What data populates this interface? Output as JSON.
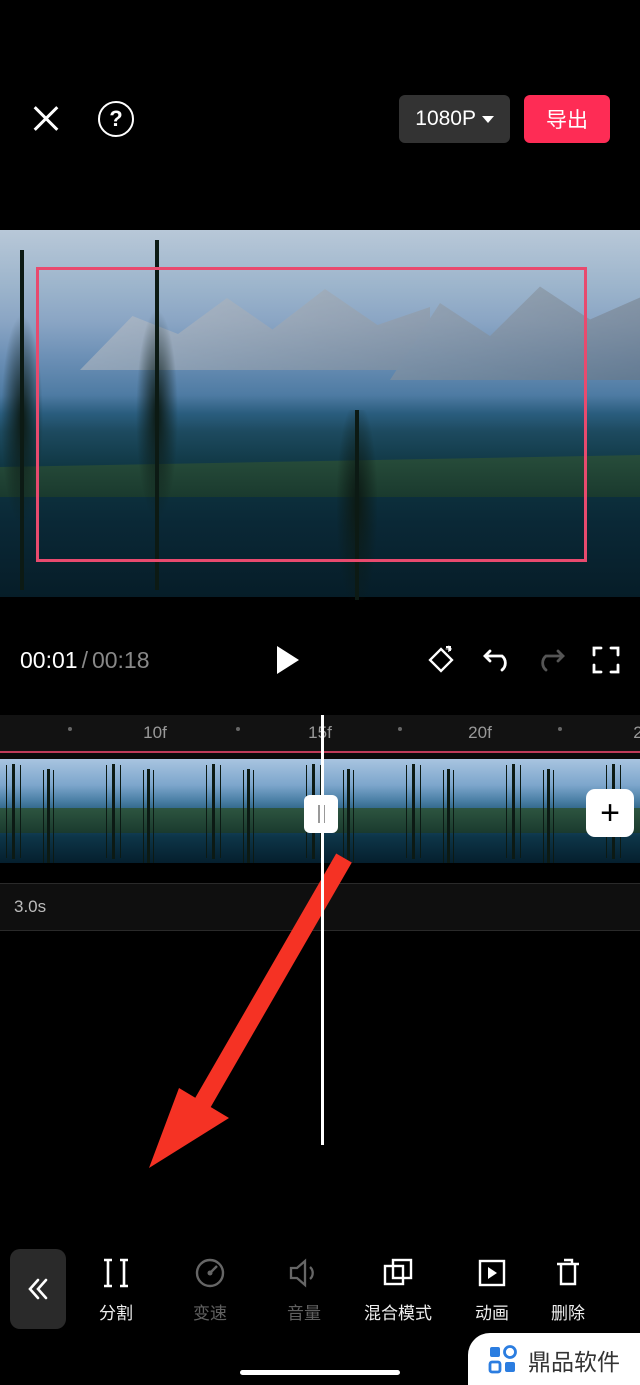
{
  "header": {
    "resolution": "1080P",
    "export_label": "导出"
  },
  "playback": {
    "current": "00:01",
    "total": "00:18"
  },
  "ruler": {
    "labels": [
      "10f",
      "15f",
      "20f"
    ],
    "positions": [
      155,
      320,
      480
    ]
  },
  "sub_clip_duration": "3.0s",
  "toolbar": {
    "split": "分割",
    "speed": "变速",
    "volume": "音量",
    "blend": "混合模式",
    "animation": "动画",
    "delete": "删除"
  },
  "watermark": "鼎品软件"
}
